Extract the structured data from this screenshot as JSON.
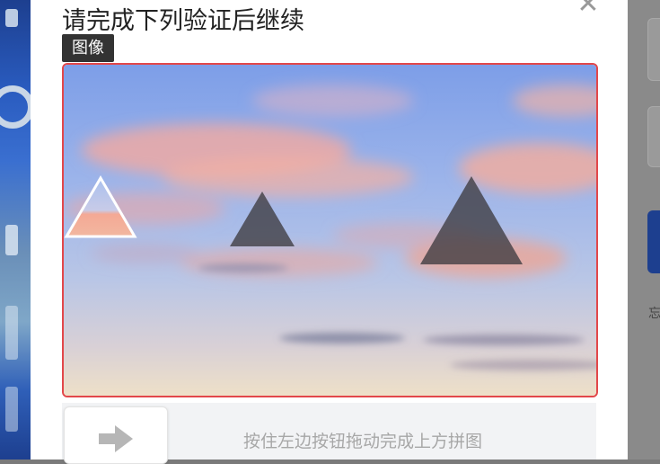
{
  "dialog": {
    "title": "请完成下列验证后继续",
    "close_icon": "close-icon",
    "image_tag": "图像"
  },
  "slider": {
    "hint": "按住左边按钮拖动完成上方拼图",
    "handle_icon": "arrow-right-icon"
  },
  "background_page": {
    "visible_text": "忘"
  }
}
